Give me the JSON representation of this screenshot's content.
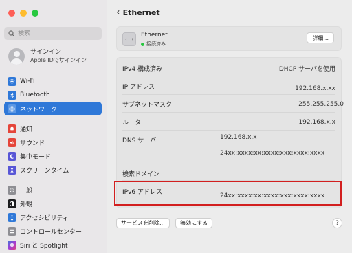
{
  "window": {
    "controls": [
      "close",
      "minimize",
      "zoom"
    ]
  },
  "sidebar": {
    "search_placeholder": "検索",
    "account": {
      "name": "サインイン",
      "subtitle": "Apple IDでサインイン"
    },
    "items": [
      {
        "label": "Wi-Fi",
        "icon": "wifi-icon",
        "color": "#2f78d8"
      },
      {
        "label": "Bluetooth",
        "icon": "bluetooth-icon",
        "color": "#2f78d8"
      },
      {
        "label": "ネットワーク",
        "icon": "globe-icon",
        "color": "#2f78d8",
        "active": true
      },
      {
        "label": "通知",
        "icon": "bell-icon",
        "color": "#e5453a"
      },
      {
        "label": "サウンド",
        "icon": "speaker-icon",
        "color": "#e5453a"
      },
      {
        "label": "集中モード",
        "icon": "moon-icon",
        "color": "#5856d6"
      },
      {
        "label": "スクリーンタイム",
        "icon": "hourglass-icon",
        "color": "#5856d6"
      },
      {
        "label": "一般",
        "icon": "gear-icon",
        "color": "#8e8e93"
      },
      {
        "label": "外観",
        "icon": "appearance-icon",
        "color": "#1c1c1e"
      },
      {
        "label": "アクセシビリティ",
        "icon": "accessibility-icon",
        "color": "#2f78d8"
      },
      {
        "label": "コントロールセンター",
        "icon": "control-center-icon",
        "color": "#8e8e93"
      },
      {
        "label": "Siri と Spotlight",
        "icon": "siri-icon",
        "color": "#a13bd6"
      }
    ]
  },
  "main": {
    "title": "Ethernet",
    "header": {
      "name": "Ethernet",
      "status": "接続済み",
      "details_label": "詳細..."
    },
    "rows": [
      {
        "label": "IPv4 構成済み",
        "value": "DHCP サーバを使用"
      },
      {
        "label": "IP アドレス",
        "value": "192.168.x.xx"
      },
      {
        "label": "サブネットマスク",
        "value": "255.255.255.0"
      },
      {
        "label": "ルーター",
        "value": "192.168.x.x"
      },
      {
        "label": "DNS サーバ",
        "values": [
          "192.168.x.x",
          "24xx:xxxx:xx:xxxx:xxx:xxxx:xxxx"
        ]
      },
      {
        "label": "検索ドメイン",
        "value": ""
      },
      {
        "label": "IPv6 アドレス",
        "value": "24xx:xxxx:xx:xxxx:xxx:xxxx:xxxx"
      }
    ],
    "buttons": {
      "remove_service": "サービスを削除...",
      "disable": "無効にする",
      "help": "?"
    },
    "highlight_color": "#d21f1f"
  }
}
